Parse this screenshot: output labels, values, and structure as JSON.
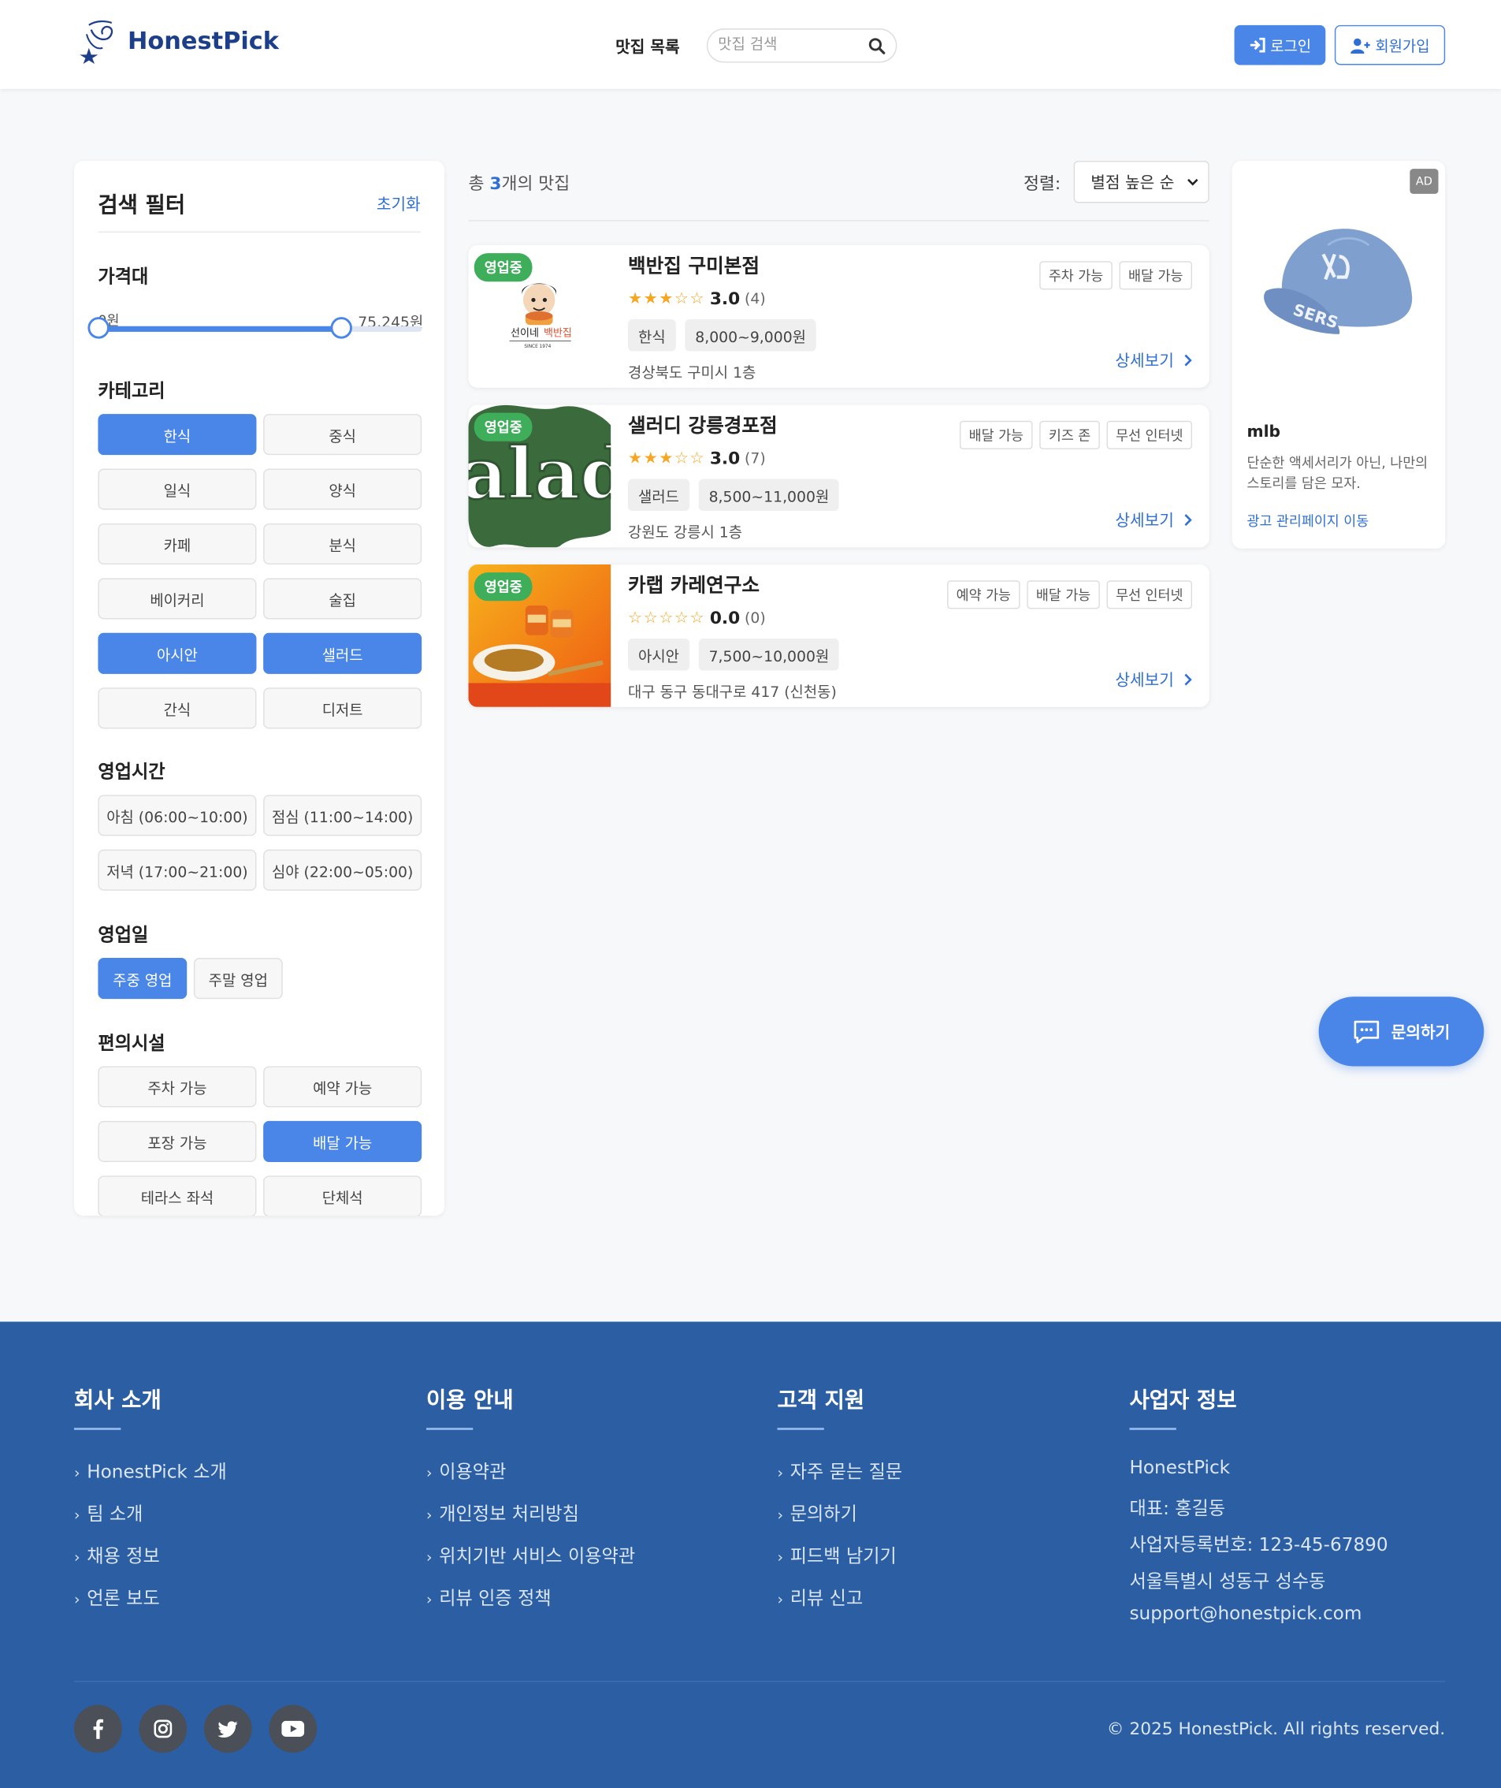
{
  "header": {
    "logo_text": "HonestPick",
    "nav_list": "맛집 목록",
    "search_placeholder": "맛집 검색",
    "login_label": "로그인",
    "signup_label": "회원가입"
  },
  "filter": {
    "title": "검색 필터",
    "reset": "초기화",
    "price": {
      "label": "가격대",
      "min_label": "0원",
      "max_label": "75,245원",
      "selected_max_fraction": 0.75
    },
    "category": {
      "label": "카테고리",
      "items": [
        {
          "label": "한식",
          "active": true
        },
        {
          "label": "중식",
          "active": false
        },
        {
          "label": "일식",
          "active": false
        },
        {
          "label": "양식",
          "active": false
        },
        {
          "label": "카페",
          "active": false
        },
        {
          "label": "분식",
          "active": false
        },
        {
          "label": "베이커리",
          "active": false
        },
        {
          "label": "술집",
          "active": false
        },
        {
          "label": "아시안",
          "active": true
        },
        {
          "label": "샐러드",
          "active": true
        },
        {
          "label": "간식",
          "active": false
        },
        {
          "label": "디저트",
          "active": false
        }
      ]
    },
    "hours": {
      "label": "영업시간",
      "items": [
        {
          "label": "아침 (06:00~10:00)",
          "active": false
        },
        {
          "label": "점심 (11:00~14:00)",
          "active": false
        },
        {
          "label": "저녁 (17:00~21:00)",
          "active": false
        },
        {
          "label": "심야 (22:00~05:00)",
          "active": false
        }
      ]
    },
    "days": {
      "label": "영업일",
      "items": [
        {
          "label": "주중 영업",
          "active": true
        },
        {
          "label": "주말 영업",
          "active": false
        }
      ]
    },
    "facilities": {
      "label": "편의시설",
      "items": [
        {
          "label": "주차 가능",
          "active": false
        },
        {
          "label": "예약 가능",
          "active": false
        },
        {
          "label": "포장 가능",
          "active": false
        },
        {
          "label": "배달 가능",
          "active": true
        },
        {
          "label": "테라스 좌석",
          "active": false
        },
        {
          "label": "단체석",
          "active": false
        }
      ]
    }
  },
  "results": {
    "count_prefix": "총 ",
    "count": "3",
    "count_suffix": "개의 맛집",
    "sort_label": "정렬:",
    "sort_value": "별점 높은 순"
  },
  "restaurants": [
    {
      "badge": "영업중",
      "name": "백반집 구미본점",
      "stars": "★★★☆☆",
      "rating": "3.0",
      "reviews": "(4)",
      "category": "한식",
      "price": "8,000~9,000원",
      "address": "경상북도 구미시 1층",
      "features": [
        "주차 가능",
        "배달 가능"
      ],
      "detail": "상세보기",
      "logo_text": "선이네 백반집"
    },
    {
      "badge": "영업중",
      "name": "샐러디 강릉경포점",
      "stars": "★★★☆☆",
      "rating": "3.0",
      "reviews": "(7)",
      "category": "샐러드",
      "price": "8,500~11,000원",
      "address": "강원도 강릉시 1층",
      "features": [
        "배달 가능",
        "키즈 존",
        "무선 인터넷"
      ],
      "detail": "상세보기",
      "logo_text": "alad"
    },
    {
      "badge": "영업중",
      "name": "카랩 카레연구소",
      "stars": "☆☆☆☆☆",
      "rating": "0.0",
      "reviews": "(0)",
      "category": "아시안",
      "price": "7,500~10,000원",
      "address": "대구 동구 동대구로 417 (신천동)",
      "features": [
        "예약 가능",
        "배달 가능",
        "무선 인터넷"
      ],
      "detail": "상세보기"
    }
  ],
  "ad": {
    "badge": "AD",
    "name": "mlb",
    "description": "단순한 액세서리가 아닌, 나만의 스토리를 담은 모자.",
    "link": "광고 관리페이지 이동"
  },
  "inquiry_button": "문의하기",
  "footer": {
    "columns": [
      {
        "title": "회사 소개",
        "links": [
          "HonestPick 소개",
          "팀 소개",
          "채용 정보",
          "언론 보도"
        ]
      },
      {
        "title": "이용 안내",
        "links": [
          "이용약관",
          "개인정보 처리방침",
          "위치기반 서비스 이용약관",
          "리뷰 인증 정책"
        ]
      },
      {
        "title": "고객 지원",
        "links": [
          "자주 묻는 질문",
          "문의하기",
          "피드백 남기기",
          "리뷰 신고"
        ]
      }
    ],
    "business": {
      "title": "사업자 정보",
      "lines": [
        "HonestPick",
        "대표: 홍길동",
        "사업자등록번호: 123-45-67890",
        "서울특별시 성동구 성수동",
        "support@honestpick.com"
      ]
    },
    "social": [
      "facebook-icon",
      "instagram-icon",
      "twitter-icon",
      "youtube-icon"
    ],
    "copyright": "© 2025 HonestPick. All rights reserved."
  },
  "colors": {
    "primary": "#4a86e8",
    "open_badge": "#3fae5a",
    "footer_bg": "#2b5ea3",
    "star": "#f5a623"
  }
}
